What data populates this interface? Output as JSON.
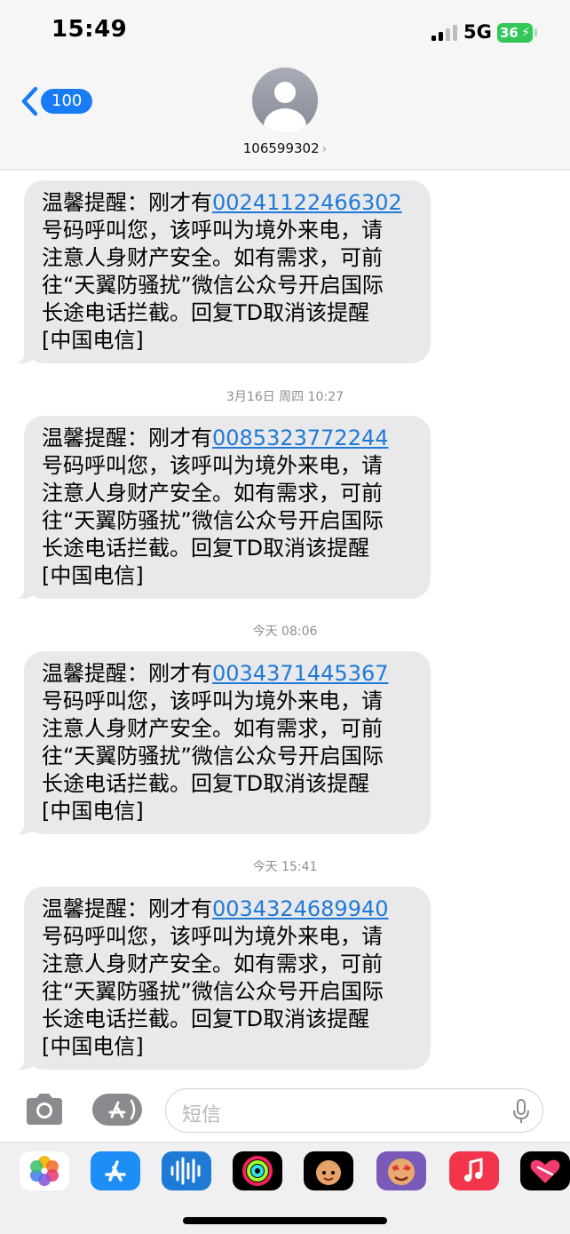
{
  "status_bar": {
    "time": "15:49",
    "network": "5G",
    "battery": "36"
  },
  "header": {
    "back_count": "100",
    "contact_name": "106599302",
    "chevron": "›"
  },
  "messages": [
    {
      "timestamp": "",
      "lines": [
        "温馨提醒：刚才有",
        "号码呼叫您，该呼叫为境外来电，请",
        "注意人身财产安全。如有需求，可前",
        "往“天翼防骚扰”微信公众号开启国际",
        "长途电话拦截。回复TD取消该提醒",
        "[中国电信]"
      ],
      "number": "00241122466302"
    },
    {
      "timestamp": "3月16日 周四 10:27",
      "lines": [
        "温馨提醒：刚才有",
        "号码呼叫您，该呼叫为境外来电，请",
        "注意人身财产安全。如有需求，可前",
        "往“天翼防骚扰”微信公众号开启国际",
        "长途电话拦截。回复TD取消该提醒",
        "[中国电信]"
      ],
      "number": "0085323772244"
    },
    {
      "timestamp": "今天 08:06",
      "lines": [
        "温馨提醒：刚才有",
        "号码呼叫您，该呼叫为境外来电，请",
        "注意人身财产安全。如有需求，可前",
        "往“天翼防骚扰”微信公众号开启国际",
        "长途电话拦截。回复TD取消该提醒",
        "[中国电信]"
      ],
      "number": "0034371445367"
    },
    {
      "timestamp": "今天 15:41",
      "lines": [
        "温馨提醒：刚才有",
        "号码呼叫您，该呼叫为境外来电，请",
        "注意人身财产安全。如有需求，可前",
        "往“天翼防骚扰”微信公众号开启国际",
        "长途电话拦截。回复TD取消该提醒",
        "[中国电信]"
      ],
      "number": "0034324689940"
    }
  ],
  "composer": {
    "placeholder": "短信"
  },
  "app_strip": [
    "photos-icon",
    "app-store-icon",
    "audio-message-icon",
    "activity-icon",
    "memoji-icon",
    "memoji-stickers-icon",
    "music-icon",
    "digital-touch-icon"
  ],
  "colors": {
    "link": "#1f7ad6",
    "bubble": "#e9e9eb",
    "accent": "#1a7cf4",
    "battery": "#33c759"
  }
}
